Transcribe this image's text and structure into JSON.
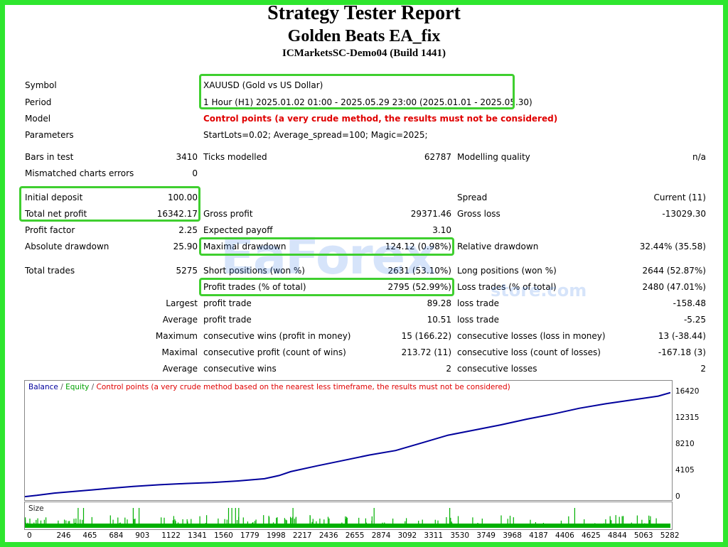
{
  "report": {
    "title": "Strategy Tester Report",
    "ea_name": "Golden Beats EA_fix",
    "server": "ICMarketsSC-Demo04 (Build 1441)"
  },
  "header_rows": [
    {
      "label": "Symbol",
      "value": "XAUUSD (Gold vs US Dollar)"
    },
    {
      "label": "Period",
      "value": "1 Hour (H1) 2025.01.02 01:00 - 2025.05.29 23:00 (2025.01.01 - 2025.05.30)"
    },
    {
      "label": "Model",
      "value": "Control points (a very crude method, the results must not be considered)"
    },
    {
      "label": "Parameters",
      "value": "StartLots=0.02; Average_spread=100; Magic=2025;"
    }
  ],
  "stats": {
    "bars_in_test_label": "Bars in test",
    "bars_in_test": "3410",
    "ticks_modelled_label": "Ticks modelled",
    "ticks_modelled": "62787",
    "modelling_quality_label": "Modelling quality",
    "modelling_quality": "n/a",
    "mismatched_label": "Mismatched charts errors",
    "mismatched": "0",
    "initial_deposit_label": "Initial deposit",
    "initial_deposit": "100.00",
    "spread_label": "Spread",
    "spread": "Current (11)",
    "total_net_profit_label": "Total net profit",
    "total_net_profit": "16342.17",
    "gross_profit_label": "Gross profit",
    "gross_profit": "29371.46",
    "gross_loss_label": "Gross loss",
    "gross_loss": "-13029.30",
    "profit_factor_label": "Profit factor",
    "profit_factor": "2.25",
    "expected_payoff_label": "Expected payoff",
    "expected_payoff": "3.10",
    "absolute_drawdown_label": "Absolute drawdown",
    "absolute_drawdown": "25.90",
    "maximal_drawdown_label": "Maximal drawdown",
    "maximal_drawdown": "124.12 (0.98%)",
    "relative_drawdown_label": "Relative drawdown",
    "relative_drawdown": "32.44% (35.58)",
    "total_trades_label": "Total trades",
    "total_trades": "5275",
    "short_positions_label": "Short positions (won %)",
    "short_positions": "2631 (53.10%)",
    "long_positions_label": "Long positions (won %)",
    "long_positions": "2644 (52.87%)",
    "profit_trades_label": "Profit trades (% of total)",
    "profit_trades": "2795 (52.99%)",
    "loss_trades_label": "Loss trades (% of total)",
    "loss_trades": "2480 (47.01%)"
  },
  "detail_rows": [
    {
      "prefix": "Largest",
      "a_label": "profit trade",
      "a_value": "89.28",
      "b_label": "loss trade",
      "b_value": "-158.48"
    },
    {
      "prefix": "Average",
      "a_label": "profit trade",
      "a_value": "10.51",
      "b_label": "loss trade",
      "b_value": "-5.25"
    },
    {
      "prefix": "Maximum",
      "a_label": "consecutive wins (profit in money)",
      "a_value": "15 (166.22)",
      "b_label": "consecutive losses (loss in money)",
      "b_value": "13 (-38.44)"
    },
    {
      "prefix": "Maximal",
      "a_label": "consecutive profit (count of wins)",
      "a_value": "213.72 (11)",
      "b_label": "consecutive loss (count of losses)",
      "b_value": "-167.18 (3)"
    },
    {
      "prefix": "Average",
      "a_label": "consecutive wins",
      "a_value": "2",
      "b_label": "consecutive losses",
      "b_value": "2"
    }
  ],
  "watermark": {
    "main": "EaForex",
    "sub": "store.com"
  },
  "chart_data": {
    "type": "line",
    "legend": {
      "balance": "Balance",
      "sep1": " / ",
      "equity": "Equity",
      "sep2": " / ",
      "note": "Control points (a very crude method based on the nearest less timeframe, the results must not be considered)"
    },
    "size_label": "Size",
    "colors": {
      "balance": "#00009c",
      "equity": "#00a000",
      "note": "#e00000",
      "size": "#00b000"
    },
    "y_ticks": [
      "0",
      "4105",
      "8210",
      "12315",
      "16420"
    ],
    "ylim": [
      0,
      16420
    ],
    "xlim": [
      0,
      5384
    ],
    "x_ticks": [
      "0",
      "246",
      "465",
      "684",
      "903",
      "1122",
      "1341",
      "1560",
      "1779",
      "1998",
      "2217",
      "2436",
      "2655",
      "2874",
      "3092",
      "3311",
      "3530",
      "3749",
      "3968",
      "4187",
      "4406",
      "4625",
      "4844",
      "5063",
      "5282"
    ],
    "balance": {
      "x": [
        0,
        100,
        246,
        465,
        684,
        903,
        1122,
        1341,
        1560,
        1779,
        1998,
        2120,
        2217,
        2436,
        2655,
        2874,
        3092,
        3311,
        3530,
        3749,
        3968,
        4187,
        4406,
        4625,
        4844,
        5063,
        5282,
        5384
      ],
      "y": [
        100,
        300,
        650,
        1000,
        1350,
        1700,
        1950,
        2150,
        2300,
        2550,
        2900,
        3400,
        4000,
        4900,
        5750,
        6600,
        7300,
        8500,
        9700,
        10500,
        11300,
        12200,
        13000,
        13900,
        14600,
        15200,
        15800,
        16342
      ]
    }
  }
}
